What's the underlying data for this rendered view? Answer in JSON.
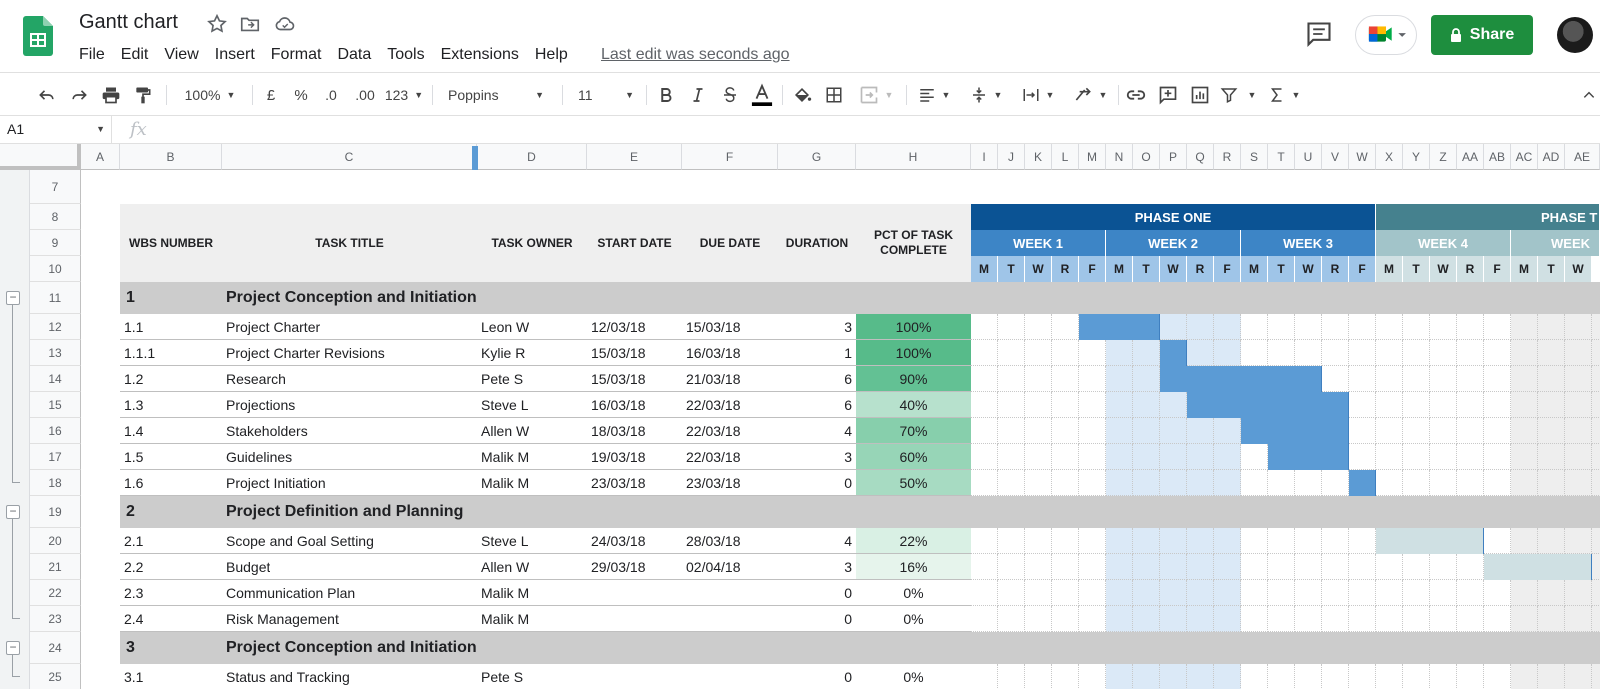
{
  "app": {
    "title": "Gantt chart",
    "last_edit": "Last edit was seconds ago",
    "share_label": "Share",
    "menu": [
      "File",
      "Edit",
      "View",
      "Insert",
      "Format",
      "Data",
      "Tools",
      "Extensions",
      "Help"
    ]
  },
  "toolbar": {
    "zoom": "100%",
    "currency": "£",
    "percent": "%",
    "decimal_decrease": ".0",
    "decimal_increase": ".00",
    "number_format": "123",
    "font": "Poppins",
    "font_size": "11"
  },
  "formula_bar": {
    "name_box": "A1",
    "fx": "fx"
  },
  "columns": [
    "A",
    "B",
    "C",
    "D",
    "E",
    "F",
    "G",
    "H",
    "I",
    "J",
    "K",
    "L",
    "M",
    "N",
    "O",
    "P",
    "Q",
    "R",
    "S",
    "T",
    "U",
    "V",
    "W",
    "X",
    "Y",
    "Z",
    "AA",
    "AB",
    "AC",
    "AD",
    "AE"
  ],
  "rows": [
    "7",
    "8",
    "9",
    "10",
    "11",
    "12",
    "13",
    "14",
    "15",
    "16",
    "17",
    "18",
    "19",
    "20",
    "21",
    "22",
    "23",
    "24",
    "25"
  ],
  "headers": {
    "wbs": "WBS NUMBER",
    "task": "TASK TITLE",
    "owner": "TASK OWNER",
    "start": "START DATE",
    "due": "DUE DATE",
    "duration": "DURATION",
    "pct": "PCT OF TASK COMPLETE"
  },
  "phases": [
    "PHASE ONE",
    "PHASE T"
  ],
  "weeks": [
    "WEEK 1",
    "WEEK 2",
    "WEEK 3",
    "WEEK 4",
    "WEEK"
  ],
  "days": [
    "M",
    "T",
    "W",
    "R",
    "F",
    "M",
    "T",
    "W",
    "R",
    "F",
    "M",
    "T",
    "W",
    "R",
    "F",
    "M",
    "T",
    "W",
    "R",
    "F",
    "M",
    "T",
    "W"
  ],
  "tasks": [
    {
      "type": "section",
      "wbs": "1",
      "title": "Project Conception and Initiation"
    },
    {
      "type": "task",
      "wbs": "1.1",
      "title": "Project Charter",
      "owner": "Leon W",
      "start": "12/03/18",
      "due": "15/03/18",
      "duration": "3",
      "pct": "100%",
      "pct_color": "#57bb8a",
      "bar": [
        4,
        6
      ],
      "bar_color": "#5b9bd5"
    },
    {
      "type": "task",
      "wbs": "1.1.1",
      "title": "Project Charter Revisions",
      "owner": "Kylie R",
      "start": "15/03/18",
      "due": "16/03/18",
      "duration": "1",
      "pct": "100%",
      "pct_color": "#57bb8a",
      "bar": [
        7,
        7
      ],
      "bar_color": "#5b9bd5"
    },
    {
      "type": "task",
      "wbs": "1.2",
      "title": "Research",
      "owner": "Pete S",
      "start": "15/03/18",
      "due": "21/03/18",
      "duration": "6",
      "pct": "90%",
      "pct_color": "#63c194",
      "bar": [
        7,
        12
      ],
      "bar_color": "#5b9bd5"
    },
    {
      "type": "task",
      "wbs": "1.3",
      "title": "Projections",
      "owner": "Steve L",
      "start": "16/03/18",
      "due": "22/03/18",
      "duration": "6",
      "pct": "40%",
      "pct_color": "#b7e1cd",
      "bar": [
        8,
        13
      ],
      "bar_color": "#5b9bd5"
    },
    {
      "type": "task",
      "wbs": "1.4",
      "title": "Stakeholders",
      "owner": "Allen W",
      "start": "18/03/18",
      "due": "22/03/18",
      "duration": "4",
      "pct": "70%",
      "pct_color": "#87cfac",
      "bar": [
        10,
        13
      ],
      "bar_color": "#5b9bd5"
    },
    {
      "type": "task",
      "wbs": "1.5",
      "title": "Guidelines",
      "owner": "Malik M",
      "start": "19/03/18",
      "due": "22/03/18",
      "duration": "3",
      "pct": "60%",
      "pct_color": "#97d5b7",
      "bar": [
        11,
        13
      ],
      "bar_color": "#5b9bd5"
    },
    {
      "type": "task",
      "wbs": "1.6",
      "title": "Project Initiation",
      "owner": "Malik M",
      "start": "23/03/18",
      "due": "23/03/18",
      "duration": "0",
      "pct": "50%",
      "pct_color": "#a7dbc2",
      "bar": [
        14,
        14
      ],
      "bar_color": "#5b9bd5"
    },
    {
      "type": "section",
      "wbs": "2",
      "title": "Project Definition and Planning"
    },
    {
      "type": "task",
      "wbs": "2.1",
      "title": "Scope and Goal Setting",
      "owner": "Steve L",
      "start": "24/03/18",
      "due": "28/03/18",
      "duration": "4",
      "pct": "22%",
      "pct_color": "#d9f0e4",
      "bar": [
        15,
        18
      ],
      "bar_color": "#cfe0e3"
    },
    {
      "type": "task",
      "wbs": "2.2",
      "title": "Budget",
      "owner": "Allen W",
      "start": "29/03/18",
      "due": "02/04/18",
      "duration": "3",
      "pct": "16%",
      "pct_color": "#e6f4ec",
      "bar": [
        19,
        22
      ],
      "bar_color": "#cfe0e3"
    },
    {
      "type": "task",
      "wbs": "2.3",
      "title": "Communication Plan",
      "owner": "Malik M",
      "start": "",
      "due": "",
      "duration": "0",
      "pct": "0%",
      "pct_color": "#ffffff",
      "bar": null,
      "bar_color": ""
    },
    {
      "type": "task",
      "wbs": "2.4",
      "title": "Risk Management",
      "owner": "Malik M",
      "start": "",
      "due": "",
      "duration": "0",
      "pct": "0%",
      "pct_color": "#ffffff",
      "bar": null,
      "bar_color": ""
    },
    {
      "type": "section",
      "wbs": "3",
      "title": "Project Conception and Initiation"
    },
    {
      "type": "task",
      "wbs": "3.1",
      "title": "Status and Tracking",
      "owner": "Pete S",
      "start": "",
      "due": "",
      "duration": "0",
      "pct": "0%",
      "pct_color": "#ffffff",
      "bar": null,
      "bar_color": ""
    }
  ],
  "colors": {
    "phase_one": "#0b5394",
    "phase_two": "#45818e",
    "week_phase_one": "#3d85c6",
    "week_phase_two": "#a2c4c9",
    "day_phase_one": "#9fc5e8",
    "day_phase_two": "#d0e0e3",
    "week2_band": "#dbe9f7",
    "weekend_band": "#eeeeee",
    "section_bg": "#cccccc",
    "share": "#1e8e3e"
  }
}
